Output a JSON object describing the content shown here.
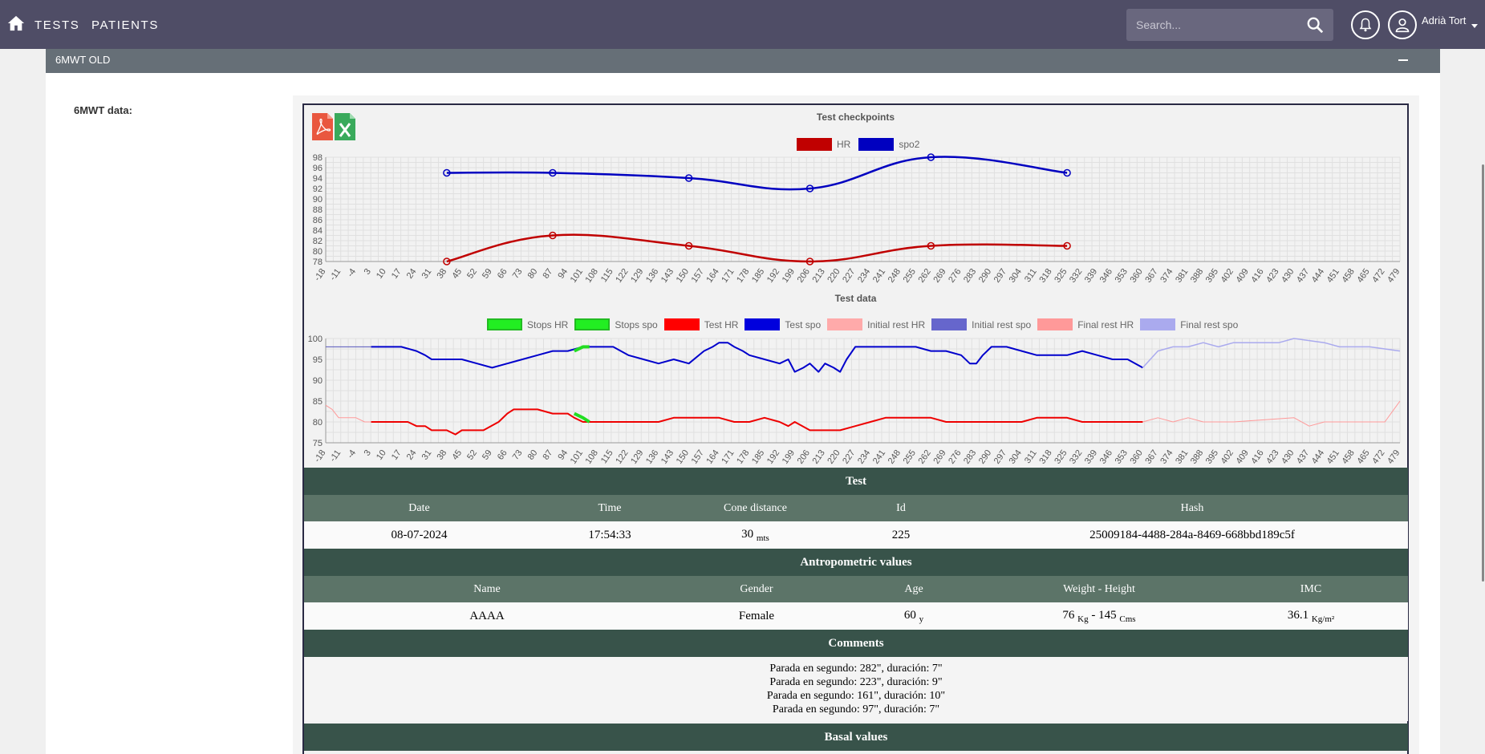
{
  "topbar": {
    "nav": [
      "TESTS",
      "PATIENTS"
    ],
    "search_placeholder": "Search...",
    "user_name": "Adrià Tort"
  },
  "panel": {
    "title": "6MWT OLD"
  },
  "section_label": "6MWT data:",
  "checkpoint_chart": {
    "title": "Test checkpoints",
    "legend": [
      {
        "label": "HR",
        "color": "#c00000"
      },
      {
        "label": "spo2",
        "color": "#0000c0"
      }
    ]
  },
  "test_chart": {
    "title": "Test data",
    "legend": [
      {
        "label": "Stops HR",
        "color": "#22ee22"
      },
      {
        "label": "Stops spo",
        "color": "#22ee22"
      },
      {
        "label": "Test HR",
        "color": "#ff0000"
      },
      {
        "label": "Test spo",
        "color": "#0000dd"
      },
      {
        "label": "Initial rest HR",
        "color": "#ffaaaa"
      },
      {
        "label": "Initial rest spo",
        "color": "#6666cc"
      },
      {
        "label": "Final rest HR",
        "color": "#ff9999"
      },
      {
        "label": "Final rest spo",
        "color": "#aaaaee"
      }
    ]
  },
  "chart_data": [
    {
      "type": "line",
      "title": "Test checkpoints",
      "x_ticks": [
        "-18",
        "-11",
        "-4",
        "3",
        "10",
        "17",
        "24",
        "31",
        "38",
        "45",
        "52",
        "59",
        "66",
        "73",
        "80",
        "87",
        "94",
        "101",
        "108",
        "115",
        "122",
        "129",
        "136",
        "143",
        "150",
        "157",
        "164",
        "171",
        "178",
        "185",
        "192",
        "199",
        "206",
        "213",
        "220",
        "227",
        "234",
        "241",
        "248",
        "255",
        "262",
        "269",
        "276",
        "283",
        "290",
        "297",
        "304",
        "311",
        "318",
        "325",
        "332",
        "339",
        "346",
        "353",
        "360",
        "367",
        "374",
        "381",
        "388",
        "395",
        "402",
        "409",
        "416",
        "423",
        "430",
        "437",
        "444",
        "451",
        "458",
        "465",
        "472",
        "479"
      ],
      "y_ticks": [
        "78",
        "80",
        "82",
        "84",
        "86",
        "88",
        "90",
        "92",
        "94",
        "96",
        "98"
      ],
      "ylim": [
        78,
        98
      ],
      "series": [
        {
          "name": "HR",
          "x": [
            38,
            87,
            150,
            206,
            262,
            325
          ],
          "values": [
            78,
            83,
            81,
            78,
            81,
            81
          ]
        },
        {
          "name": "spo2",
          "x": [
            38,
            87,
            150,
            206,
            262,
            325
          ],
          "values": [
            95,
            95,
            94,
            92,
            98,
            95
          ]
        }
      ]
    },
    {
      "type": "line",
      "title": "Test data",
      "x_ticks": [
        "-18",
        "-11",
        "-4",
        "3",
        "10",
        "17",
        "24",
        "31",
        "38",
        "45",
        "52",
        "59",
        "66",
        "73",
        "80",
        "87",
        "94",
        "101",
        "108",
        "115",
        "122",
        "129",
        "136",
        "143",
        "150",
        "157",
        "164",
        "171",
        "178",
        "185",
        "192",
        "199",
        "206",
        "213",
        "220",
        "227",
        "234",
        "241",
        "248",
        "255",
        "262",
        "269",
        "276",
        "283",
        "290",
        "297",
        "304",
        "311",
        "318",
        "325",
        "332",
        "339",
        "346",
        "353",
        "360",
        "367",
        "374",
        "381",
        "388",
        "395",
        "402",
        "409",
        "416",
        "423",
        "430",
        "437",
        "444",
        "451",
        "458",
        "465",
        "472",
        "479"
      ],
      "y_ticks": [
        "75",
        "80",
        "85",
        "90",
        "95",
        "100"
      ],
      "ylim": [
        75,
        100
      ],
      "series": [
        {
          "name": "Initial rest HR",
          "x": [
            -18,
            -15,
            -12,
            -8,
            -4,
            0,
            3
          ],
          "values": [
            84,
            83,
            81,
            81,
            81,
            80,
            80
          ]
        },
        {
          "name": "Initial rest spo",
          "x": [
            -18,
            -10,
            -4,
            0,
            3
          ],
          "values": [
            98,
            98,
            98,
            98,
            98
          ]
        },
        {
          "name": "Test HR",
          "x": [
            3,
            20,
            24,
            28,
            31,
            35,
            38,
            42,
            45,
            47,
            50,
            55,
            62,
            66,
            69,
            72,
            80,
            87,
            94,
            97,
            101,
            104,
            108,
            122,
            136,
            143,
            157,
            164,
            171,
            178,
            185,
            192,
            196,
            199,
            206,
            213,
            220,
            227,
            234,
            241,
            248,
            262,
            269,
            276,
            283,
            290,
            297,
            304,
            311,
            318,
            325,
            332,
            339,
            346,
            353,
            360
          ],
          "values": [
            80,
            80,
            79,
            79,
            78,
            78,
            78,
            77,
            78,
            78,
            78,
            78,
            80,
            82,
            83,
            83,
            83,
            82,
            82,
            81,
            80,
            80,
            80,
            80,
            80,
            81,
            81,
            81,
            80,
            80,
            81,
            80,
            79,
            80,
            78,
            78,
            78,
            79,
            80,
            81,
            81,
            81,
            80,
            80,
            80,
            80,
            80,
            80,
            81,
            81,
            81,
            80,
            80,
            80,
            80,
            80
          ]
        },
        {
          "name": "Test spo",
          "x": [
            3,
            17,
            24,
            28,
            31,
            38,
            45,
            52,
            59,
            66,
            73,
            80,
            87,
            94,
            101,
            108,
            115,
            122,
            129,
            136,
            143,
            150,
            157,
            161,
            164,
            168,
            171,
            175,
            178,
            185,
            192,
            196,
            199,
            203,
            206,
            210,
            213,
            217,
            220,
            223,
            227,
            230,
            234,
            241,
            248,
            255,
            262,
            269,
            276,
            280,
            283,
            286,
            290,
            297,
            304,
            311,
            318,
            325,
            332,
            339,
            346,
            353,
            360
          ],
          "values": [
            98,
            98,
            97,
            96,
            95,
            95,
            95,
            94,
            93,
            94,
            95,
            96,
            97,
            97,
            98,
            98,
            98,
            96,
            95,
            94,
            95,
            94,
            97,
            98,
            99,
            99,
            98,
            97,
            96,
            95,
            94,
            95,
            92,
            93,
            94,
            92,
            94,
            93,
            92,
            95,
            98,
            98,
            98,
            98,
            98,
            98,
            97,
            97,
            96,
            94,
            94,
            96,
            98,
            98,
            97,
            96,
            96,
            96,
            97,
            96,
            95,
            95,
            93
          ]
        },
        {
          "name": "Stops HR",
          "x": [
            97,
            101,
            104
          ],
          "values": [
            82,
            81,
            80
          ]
        },
        {
          "name": "Stops spo",
          "x": [
            97,
            101,
            104
          ],
          "values": [
            97,
            98,
            98
          ]
        },
        {
          "name": "Final rest HR",
          "x": [
            360,
            367,
            374,
            381,
            388,
            402,
            430,
            437,
            444,
            472,
            479
          ],
          "values": [
            80,
            81,
            80,
            81,
            80,
            80,
            81,
            79,
            80,
            80,
            85
          ]
        },
        {
          "name": "Final rest spo",
          "x": [
            360,
            367,
            374,
            381,
            388,
            395,
            402,
            423,
            430,
            444,
            451,
            465,
            479
          ],
          "values": [
            93,
            97,
            98,
            98,
            99,
            98,
            99,
            99,
            100,
            99,
            98,
            98,
            97
          ]
        }
      ]
    }
  ],
  "test_table": {
    "section": "Test",
    "headers": [
      "Date",
      "Time",
      "Cone distance",
      "Id",
      "Hash"
    ],
    "values": [
      "08-07-2024",
      "17:54:33",
      "30",
      "225",
      "25009184-4488-284a-8469-668bbd189c5f"
    ],
    "cone_unit": "mts"
  },
  "antro_table": {
    "section": "Antropometric values",
    "headers": [
      "Name",
      "Gender",
      "Age",
      "Weight - Height",
      "IMC"
    ],
    "name": "AAAA",
    "gender": "Female",
    "age": "60",
    "age_unit": "y",
    "weight": "76",
    "weight_unit": "Kg",
    "height_sep": " - ",
    "height": "145",
    "height_unit": "Cms",
    "imc": "36.1",
    "imc_unit": "Kg/m²"
  },
  "comments": {
    "section": "Comments",
    "lines": [
      "Parada en segundo: 282\", duración: 7\"",
      "Parada en segundo: 223\", duración: 9\"",
      "Parada en segundo: 161\", duración: 10\"",
      "Parada en segundo: 97\", duración: 7\""
    ]
  },
  "basal": {
    "section": "Basal values"
  }
}
